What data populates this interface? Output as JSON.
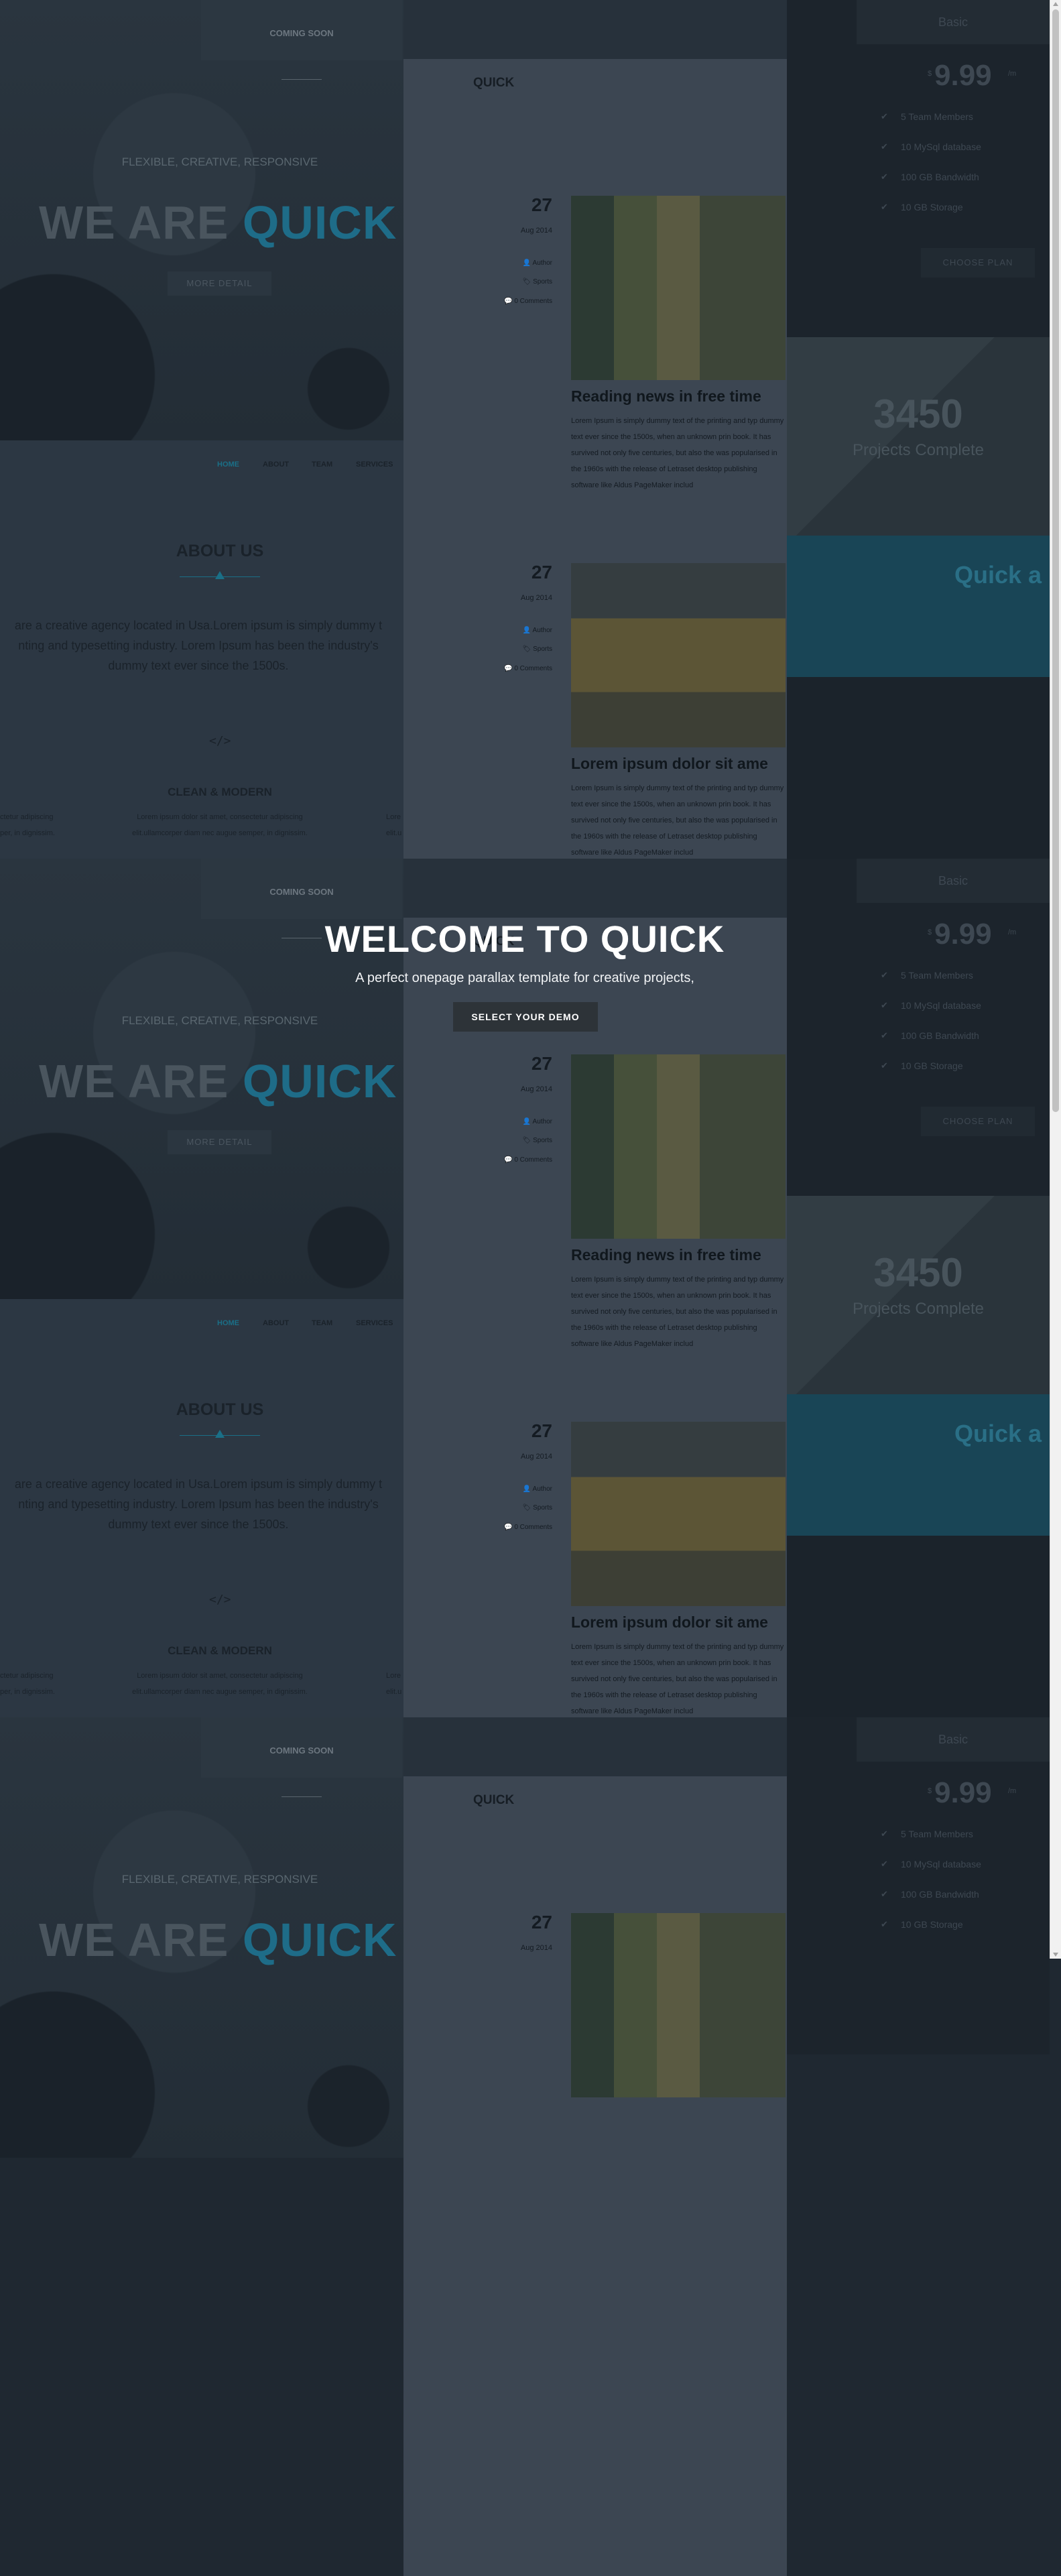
{
  "hero": {
    "coming_soon": "COMING SOON",
    "tagline": "FLEXIBLE, CREATIVE, RESPONSIVE",
    "headline_plain": "WE ARE",
    "headline_accent": "QUICK",
    "more_detail": "MORE DETAIL"
  },
  "nav": {
    "items": [
      "HOME",
      "ABOUT",
      "TEAM",
      "SERVICES"
    ]
  },
  "about": {
    "title": "ABOUT US",
    "text_line1": "are a creative agency located in Usa.Lorem ipsum is simply dummy t",
    "text_line2": "nting and typesetting industry. Lorem Ipsum has been the industry's",
    "text_line3": "dummy text ever since the 1500s.",
    "icon_glyph": "</>",
    "feature_title": "CLEAN & MODERN",
    "feature_text_line1": "Lorem ipsum dolor sit amet, consectetur adipiscing",
    "feature_text_line2": "elit.ullamcorper diam nec augue semper, in dignissim.",
    "left_edge_line1": "ctetur adipiscing",
    "left_edge_line2": "per, in dignissim.",
    "right_edge_line1": "Lore",
    "right_edge_line2": "elit.u"
  },
  "blog": {
    "logo": "QUICK",
    "posts": [
      {
        "day": "27",
        "month": "Aug 2014",
        "author": "Author",
        "category": "Sports",
        "comments": "0 Comments",
        "title": "Reading news in free time",
        "body": "Lorem Ipsum is simply dummy text of the printing and typ dummy text ever since the 1500s, when an unknown prin book. It has survived not only five centuries, but also the was popularised in the 1960s with the release of Letraset desktop publishing software like Aldus PageMaker includ"
      },
      {
        "day": "27",
        "month": "Aug 2014",
        "author": "Author",
        "category": "Sports",
        "comments": "0 Comments",
        "title": "Lorem ipsum dolor sit ame",
        "body": "Lorem Ipsum is simply dummy text of the printing and typ dummy text ever since the 1500s, when an unknown prin book. It has survived not only five centuries, but also the was popularised in the 1960s with the release of Letraset desktop publishing software like Aldus PageMaker includ"
      }
    ]
  },
  "pricing": {
    "plan": "Basic",
    "currency": "$",
    "amount": "9.99",
    "unit": "/m",
    "features": [
      "5 Team Members",
      "10 MySql database",
      "100 GB Bandwidth",
      "10 GB Storage"
    ],
    "check_glyph": "✔",
    "choose_label": "CHOOSE PLAN"
  },
  "stats": {
    "number": "3450",
    "label": "Projects Complete"
  },
  "banner": {
    "text": "Quick a"
  },
  "welcome": {
    "title": "WELCOME TO QUICK",
    "subtitle": "A perfect onepage parallax template for creative projects,",
    "button": "SELECT YOUR DEMO"
  },
  "colors": {
    "accent": "#1e6c88",
    "overlay_background": "#1f2831",
    "button_background": "#2d3338"
  }
}
